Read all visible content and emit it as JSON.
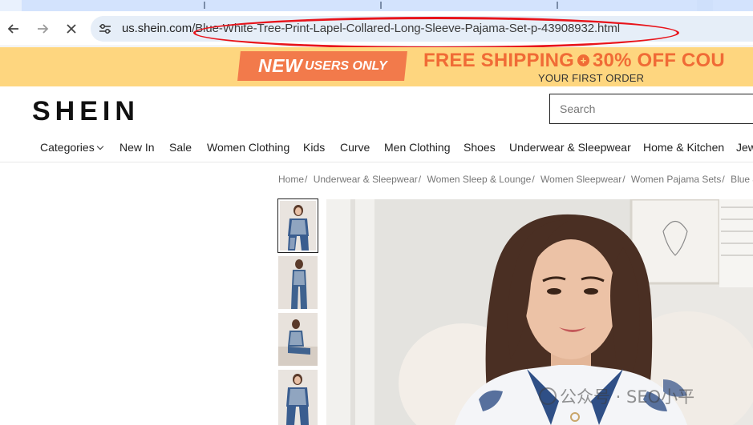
{
  "browser": {
    "url_host": "us.shein.com",
    "url_path": "/Blue-White-Tree-Print-Lapel-Collared-Long-Sleeve-Pajama-Set-p-43908932.html",
    "icons": {
      "back": "back-arrow-icon",
      "forward": "forward-arrow-icon",
      "stop": "close-icon",
      "site_info": "tune-icon"
    }
  },
  "promo": {
    "badge_new": "NEW",
    "badge_rest": "USERS ONLY",
    "line1_a": "FREE SHIPPING",
    "line1_plus": "+",
    "line1_b": "30% OFF COU",
    "line2": "YOUR FIRST ORDER",
    "colors": {
      "background": "#fed67f",
      "accent": "#f06b36",
      "badge": "#f27a4b"
    }
  },
  "header": {
    "logo": "SHEIN",
    "search_placeholder": "Search"
  },
  "nav": {
    "items": [
      "Categories",
      "New In",
      "Sale",
      "Women Clothing",
      "Kids",
      "Curve",
      "Men Clothing",
      "Shoes",
      "Underwear & Sleepwear",
      "Home & Kitchen",
      "Jew"
    ]
  },
  "breadcrumb": {
    "items": [
      "Home",
      "Underwear & Sleepwear",
      "Women Sleep & Lounge",
      "Women Sleepwear",
      "Women Pajama Sets",
      "Blue &"
    ],
    "separator": "/"
  },
  "watermark": {
    "text": "公众号 · SEO小平"
  }
}
